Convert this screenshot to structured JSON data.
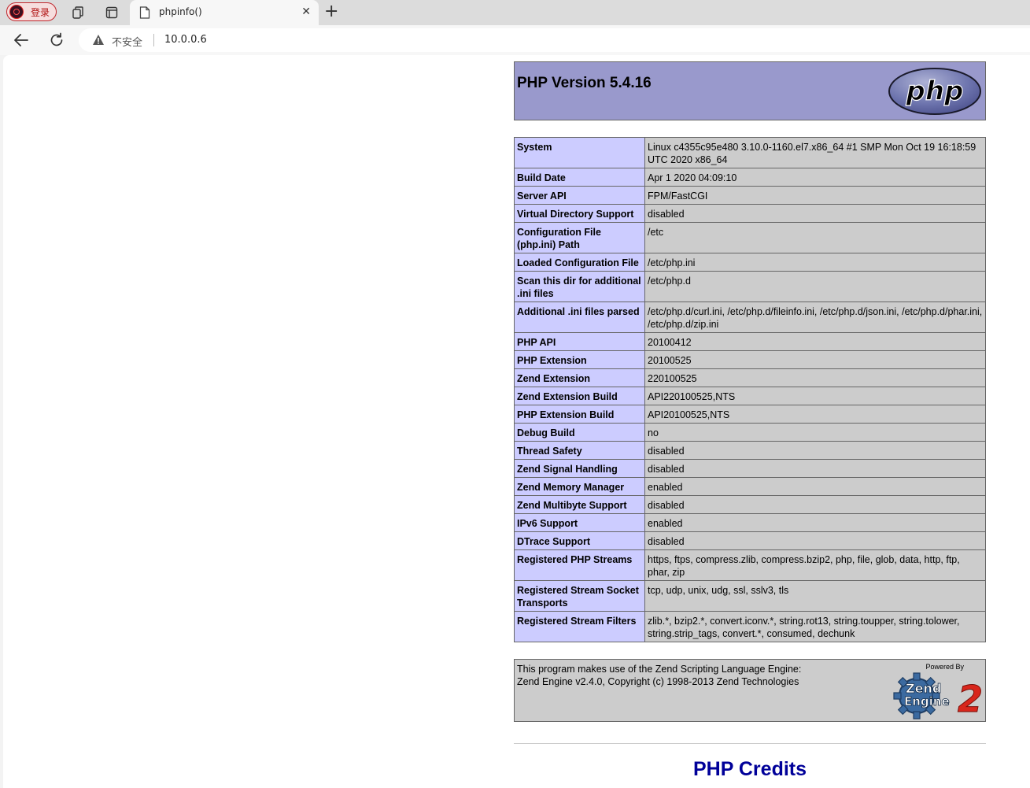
{
  "browser": {
    "profile_label": "登录",
    "tab_title": "phpinfo()",
    "security_label": "不安全",
    "url": "10.0.0.6"
  },
  "header": {
    "title": "PHP Version 5.4.16",
    "logo_text": "php"
  },
  "info_rows": [
    {
      "key": "System",
      "value": "Linux c4355c95e480 3.10.0-1160.el7.x86_64 #1 SMP Mon Oct 19 16:18:59 UTC 2020 x86_64"
    },
    {
      "key": "Build Date",
      "value": "Apr 1 2020 04:09:10"
    },
    {
      "key": "Server API",
      "value": "FPM/FastCGI"
    },
    {
      "key": "Virtual Directory Support",
      "value": "disabled"
    },
    {
      "key": "Configuration File (php.ini) Path",
      "value": "/etc"
    },
    {
      "key": "Loaded Configuration File",
      "value": "/etc/php.ini"
    },
    {
      "key": "Scan this dir for additional .ini files",
      "value": "/etc/php.d"
    },
    {
      "key": "Additional .ini files parsed",
      "value": "/etc/php.d/curl.ini, /etc/php.d/fileinfo.ini, /etc/php.d/json.ini, /etc/php.d/phar.ini, /etc/php.d/zip.ini"
    },
    {
      "key": "PHP API",
      "value": "20100412"
    },
    {
      "key": "PHP Extension",
      "value": "20100525"
    },
    {
      "key": "Zend Extension",
      "value": "220100525"
    },
    {
      "key": "Zend Extension Build",
      "value": "API220100525,NTS"
    },
    {
      "key": "PHP Extension Build",
      "value": "API20100525,NTS"
    },
    {
      "key": "Debug Build",
      "value": "no"
    },
    {
      "key": "Thread Safety",
      "value": "disabled"
    },
    {
      "key": "Zend Signal Handling",
      "value": "disabled"
    },
    {
      "key": "Zend Memory Manager",
      "value": "enabled"
    },
    {
      "key": "Zend Multibyte Support",
      "value": "disabled"
    },
    {
      "key": "IPv6 Support",
      "value": "enabled"
    },
    {
      "key": "DTrace Support",
      "value": "disabled"
    },
    {
      "key": "Registered PHP Streams",
      "value": "https, ftps, compress.zlib, compress.bzip2, php, file, glob, data, http, ftp, phar, zip"
    },
    {
      "key": "Registered Stream Socket Transports",
      "value": "tcp, udp, unix, udg, ssl, sslv3, tls"
    },
    {
      "key": "Registered Stream Filters",
      "value": "zlib.*, bzip2.*, convert.iconv.*, string.rot13, string.toupper, string.tolower, string.strip_tags, convert.*, consumed, dechunk"
    }
  ],
  "zend": {
    "line1": "This program makes use of the Zend Scripting Language Engine:",
    "line2": "Zend Engine v2.4.0, Copyright (c) 1998-2013 Zend Technologies",
    "powered_by": "Powered By",
    "logo_word1": "Zend",
    "logo_word2": "Engine",
    "logo_number": "2"
  },
  "credits_heading": "PHP Credits",
  "colors": {
    "header_bg": "#9999cc",
    "key_bg": "#ccccff",
    "value_bg": "#cccccc",
    "credits_color": "#000099"
  }
}
